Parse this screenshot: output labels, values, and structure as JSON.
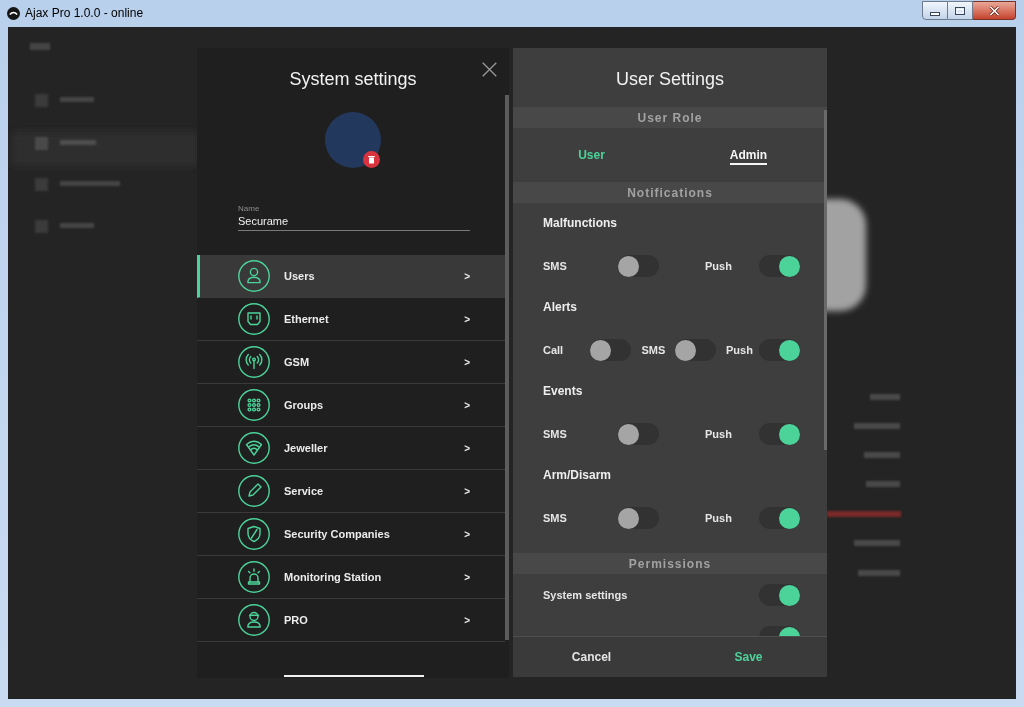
{
  "window": {
    "title": "Ajax Pro 1.0.0 - online"
  },
  "system_settings": {
    "title": "System settings",
    "name_field": {
      "label": "Name",
      "value": "Securame"
    },
    "menu": [
      {
        "kind": "users",
        "label": "Users",
        "chevron": ">",
        "selected": true
      },
      {
        "kind": "ethernet",
        "label": "Ethernet",
        "chevron": ">",
        "selected": false
      },
      {
        "kind": "gsm",
        "label": "GSM",
        "chevron": ">",
        "selected": false
      },
      {
        "kind": "groups",
        "label": "Groups",
        "chevron": ">",
        "selected": false
      },
      {
        "kind": "jeweller",
        "label": "Jeweller",
        "chevron": ">",
        "selected": false
      },
      {
        "kind": "service",
        "label": "Service",
        "chevron": ">",
        "selected": false
      },
      {
        "kind": "security",
        "label": "Security Companies",
        "chevron": ">",
        "selected": false
      },
      {
        "kind": "monitoring",
        "label": "Monitoring Station",
        "chevron": ">",
        "selected": false
      },
      {
        "kind": "pro",
        "label": "PRO",
        "chevron": ">",
        "selected": false
      }
    ]
  },
  "user_settings": {
    "title": "User Settings",
    "sections": [
      {
        "kind": "role",
        "header": "User Role",
        "options": [
          {
            "label": "User",
            "selected": false
          },
          {
            "label": "Admin",
            "selected": true
          }
        ]
      },
      {
        "kind": "notifications",
        "header": "Notifications",
        "groups": [
          {
            "title": "Malfunctions",
            "toggles": [
              {
                "label": "SMS",
                "on": false
              },
              {
                "label": "Push",
                "on": true
              }
            ]
          },
          {
            "title": "Alerts",
            "toggles": [
              {
                "label": "Call",
                "on": false
              },
              {
                "label": "SMS",
                "on": false
              },
              {
                "label": "Push",
                "on": true
              }
            ]
          },
          {
            "title": "Events",
            "toggles": [
              {
                "label": "SMS",
                "on": false
              },
              {
                "label": "Push",
                "on": true
              }
            ]
          },
          {
            "title": "Arm/Disarm",
            "toggles": [
              {
                "label": "SMS",
                "on": false
              },
              {
                "label": "Push",
                "on": true
              }
            ]
          }
        ]
      },
      {
        "kind": "permissions",
        "header": "Permissions",
        "items": [
          {
            "label": "System settings",
            "on": true
          },
          {
            "on": true
          }
        ]
      }
    ]
  },
  "footer": {
    "buttons": [
      {
        "kind": "cancel",
        "label": "Cancel"
      },
      {
        "kind": "save",
        "label": "Save"
      }
    ]
  }
}
